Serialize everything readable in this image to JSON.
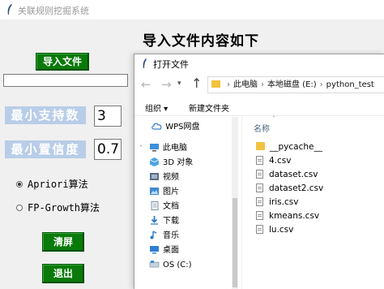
{
  "window": {
    "title": "关联规则挖掘系统"
  },
  "heading": "导入文件内容如下",
  "import_button": "导入文件",
  "path_value": "",
  "min_support": {
    "label": "最小支持数",
    "value": "3"
  },
  "min_confidence": {
    "label": "最小置信度",
    "value": "0.7"
  },
  "algorithms": [
    {
      "label": "Apriori算法",
      "selected": true
    },
    {
      "label": "FP-Growth算法",
      "selected": false
    }
  ],
  "clear_button": "清屏",
  "exit_button": "退出",
  "dialog": {
    "title": "打开文件",
    "breadcrumbs": [
      "此电脑",
      "本地磁盘 (E:)",
      "python_test"
    ],
    "organize": "组织 ▾",
    "new_folder": "新建文件夹",
    "column_name": "名称",
    "nav_items": [
      {
        "label": "WPS网盘",
        "icon": "cloud-icon"
      },
      {
        "label": "此电脑",
        "icon": "computer-icon"
      },
      {
        "label": "3D 对象",
        "icon": "cube-icon"
      },
      {
        "label": "视频",
        "icon": "video-icon"
      },
      {
        "label": "图片",
        "icon": "picture-icon"
      },
      {
        "label": "文档",
        "icon": "document-icon"
      },
      {
        "label": "下载",
        "icon": "download-icon"
      },
      {
        "label": "音乐",
        "icon": "music-icon"
      },
      {
        "label": "桌面",
        "icon": "desktop-icon"
      },
      {
        "label": "OS (C:)",
        "icon": "drive-icon"
      }
    ],
    "files": [
      {
        "name": "__pycache__",
        "type": "folder"
      },
      {
        "name": "4.csv",
        "type": "file"
      },
      {
        "name": "dataset.csv",
        "type": "file"
      },
      {
        "name": "dataset2.csv",
        "type": "file"
      },
      {
        "name": "iris.csv",
        "type": "file"
      },
      {
        "name": "kmeans.csv",
        "type": "file"
      },
      {
        "name": "lu.csv",
        "type": "file"
      }
    ]
  },
  "colors": {
    "button_green": "#0a7a0a",
    "label_blue": "#b8cde8",
    "folder_yellow": "#f3c33f"
  }
}
